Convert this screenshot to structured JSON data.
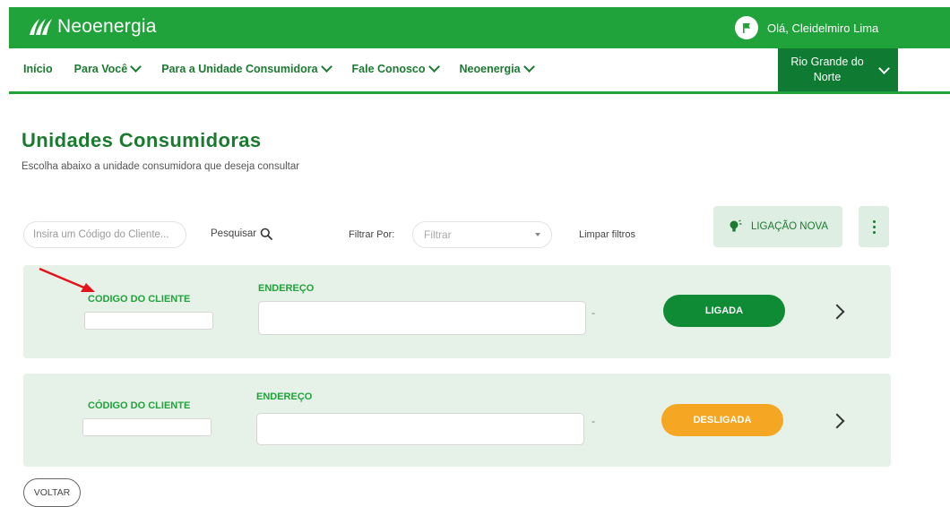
{
  "header": {
    "brand": "Neoenergia",
    "greeting": "Olá, Cleidelmiro Lima",
    "brand_color": "#1fa33a"
  },
  "nav": {
    "items": [
      {
        "label": "Início",
        "has_menu": false
      },
      {
        "label": "Para Você",
        "has_menu": true
      },
      {
        "label": "Para a Unidade Consumidora",
        "has_menu": true
      },
      {
        "label": "Fale Conosco",
        "has_menu": true
      },
      {
        "label": "Neoenergia",
        "has_menu": true
      }
    ],
    "region_line1": "Rio Grande do",
    "region_line2": "Norte"
  },
  "page": {
    "title": "Unidades Consumidoras",
    "subtitle": "Escolha abaixo a unidade consumidora que deseja consultar"
  },
  "filters": {
    "search_placeholder": "Insira um Código do Cliente...",
    "search_label": "Pesquisar",
    "filter_by_label": "Filtrar Por:",
    "filter_placeholder": "Filtrar",
    "clear_label": "Limpar filtros",
    "new_connection_label": "LIGAÇÃO NOVA"
  },
  "units": [
    {
      "client_code_label": "CODIGO DO CLIENTE",
      "address_label": "ENDEREÇO",
      "separator": "-",
      "status": "LIGADA",
      "status_color": "#0f8a35"
    },
    {
      "client_code_label": "CÓDIGO DO CLIENTE",
      "address_label": "ENDEREÇO",
      "separator": "-",
      "status": "DESLIGADA",
      "status_color": "#f5a623"
    }
  ],
  "footer": {
    "back_label": "VOLTAR"
  }
}
